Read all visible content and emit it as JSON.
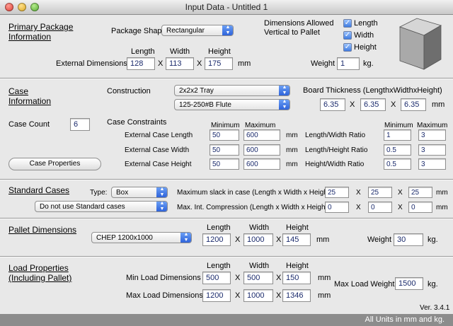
{
  "window": {
    "title": "Input Data - Untitled 1"
  },
  "primary": {
    "title_line1": "Primary Package",
    "title_line2": "Information",
    "shape_label": "Package Shape",
    "shape_value": "Rectangular",
    "dims_allowed_line1": "Dimensions Allowed",
    "dims_allowed_line2": "Vertical to Pallet",
    "chk_length": "Length",
    "chk_width": "Width",
    "chk_height": "Height",
    "col_length": "Length",
    "col_width": "Width",
    "col_height": "Height",
    "ext_dims_label": "External Dimensions",
    "length": "128",
    "width": "113",
    "height": "175",
    "unit_mm": "mm",
    "weight_label": "Weight",
    "weight": "1",
    "unit_kg": "kg."
  },
  "case": {
    "title_line1": "Case",
    "title_line2": "Information",
    "construction_label": "Construction",
    "construction_value": "2x2x2 Tray",
    "flute_value": "125-250#B Flute",
    "board_label": "Board Thickness (LengthxWidthxHeight)",
    "board_l": "6.35",
    "board_w": "6.35",
    "board_h": "6.35",
    "unit_mm": "mm",
    "count_label": "Case Count",
    "count": "6",
    "constraints_label": "Case Constraints",
    "col_min": "Minimum",
    "col_max": "Maximum",
    "ext_length_label": "External Case Length",
    "ext_width_label": "External Case Width",
    "ext_height_label": "External Case Height",
    "len_min": "50",
    "len_max": "600",
    "wid_min": "50",
    "wid_max": "600",
    "hei_min": "50",
    "hei_max": "600",
    "ratio_col_min": "Minimum",
    "ratio_col_max": "Maximum",
    "lw_label": "Length/Width Ratio",
    "lh_label": "Length/Height Ratio",
    "hw_label": "Height/Width Ratio",
    "lw_min": "1",
    "lw_max": "3",
    "lh_min": "0.5",
    "lh_max": "3",
    "hw_min": "0.5",
    "hw_max": "3",
    "properties_button": "Case Properties"
  },
  "standard": {
    "title": "Standard Cases",
    "type_label": "Type:",
    "type_value": "Box",
    "use_value": "Do not use Standard cases",
    "slack_label": "Maximum slack in case  (Length x Width x Height)",
    "slack_l": "25",
    "slack_w": "25",
    "slack_h": "25",
    "comp_label": "Max. Int. Compression (Length x Width x Height)",
    "comp_l": "0",
    "comp_w": "0",
    "comp_h": "0",
    "unit_mm": "mm"
  },
  "pallet": {
    "title": "Pallet Dimensions",
    "type_value": "CHEP 1200x1000",
    "col_length": "Length",
    "col_width": "Width",
    "col_height": "Height",
    "length": "1200",
    "width": "1000",
    "height": "145",
    "unit_mm": "mm",
    "weight_label": "Weight",
    "weight": "30",
    "unit_kg": "kg."
  },
  "load": {
    "title_line1": "Load Properties",
    "title_line2": "(Including Pallet)",
    "col_length": "Length",
    "col_width": "Width",
    "col_height": "Height",
    "min_label": "Min Load Dimensions",
    "max_label": "Max Load Dimensions",
    "min_l": "500",
    "min_w": "500",
    "min_h": "150",
    "max_l": "1200",
    "max_w": "1000",
    "max_h": "1346",
    "unit_mm": "mm",
    "max_weight_label": "Max Load Weight",
    "max_weight": "1500",
    "unit_kg": "kg."
  },
  "footer": {
    "version": "Ver. 3.4.1",
    "units_note": "All Units in mm and kg."
  },
  "x_symbol": "X"
}
